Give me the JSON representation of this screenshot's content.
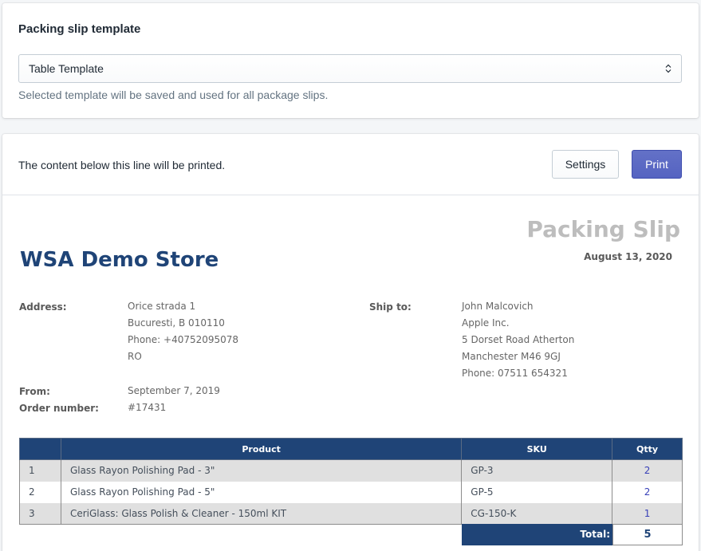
{
  "template_card": {
    "title": "Packing slip template",
    "selected": "Table Template",
    "help": "Selected template will be saved and used for all package slips."
  },
  "print_card": {
    "note": "The content below this line will be printed.",
    "settings_label": "Settings",
    "print_label": "Print"
  },
  "slip": {
    "heading": "Packing Slip",
    "date": "August 13, 2020",
    "store_name": "WSA Demo Store",
    "address_label": "Address:",
    "address_lines": [
      "Orice strada 1",
      "Bucuresti, B 010110",
      "Phone: +40752095078",
      "RO"
    ],
    "ship_to_label": "Ship to:",
    "ship_to_lines": [
      "John Malcovich",
      "Apple Inc.",
      "5 Dorset Road Atherton",
      "Manchester M46 9GJ",
      "Phone: 07511 654321"
    ],
    "from_label": "From:",
    "from_value": "September 7, 2019",
    "order_label": "Order number:",
    "order_value": "#17431"
  },
  "table": {
    "headers": [
      "",
      "Product",
      "SKU",
      "Qtty"
    ],
    "rows": [
      {
        "num": "1",
        "product": "Glass Rayon Polishing Pad - 3\"",
        "sku": "GP-3",
        "qty": "2"
      },
      {
        "num": "2",
        "product": "Glass Rayon Polishing Pad - 5\"",
        "sku": "GP-5",
        "qty": "2"
      },
      {
        "num": "3",
        "product": "CeriGlass: Glass Polish & Cleaner - 150ml KIT",
        "sku": "CG-150-K",
        "qty": "1"
      }
    ],
    "total_label": "Total:",
    "total_value": "5"
  },
  "colors": {
    "accent": "#5c6ac4",
    "table_header": "#1f4477",
    "store_name": "#1f4477"
  }
}
